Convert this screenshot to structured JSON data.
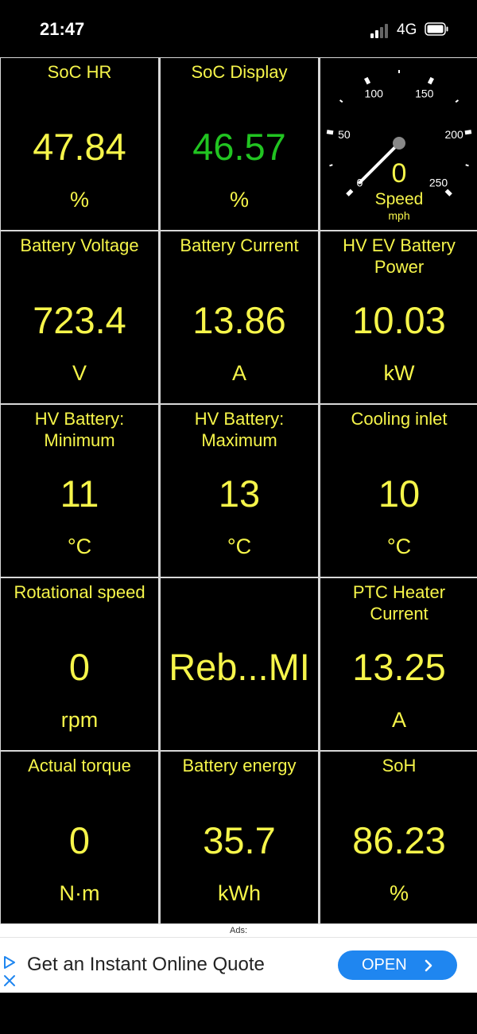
{
  "status_bar": {
    "time": "21:47",
    "network": "4G",
    "signal_bars_active": 2,
    "signal_bars_total": 4
  },
  "tiles": [
    {
      "label": "SoC HR",
      "value": "47.84",
      "unit": "%",
      "color": "#f6f54a"
    },
    {
      "label": "SoC Display",
      "value": "46.57",
      "unit": "%",
      "color": "#21c421"
    },
    {
      "type": "gauge"
    },
    {
      "label": "Battery Voltage",
      "value": "723.4",
      "unit": "V"
    },
    {
      "label": "Battery Current",
      "value": "13.86",
      "unit": "A"
    },
    {
      "label": "HV EV Battery Power",
      "value": "10.03",
      "unit": "kW"
    },
    {
      "label": "HV Battery: Minimum",
      "value": "11",
      "unit": "°C"
    },
    {
      "label": "HV Battery: Maximum",
      "value": "13",
      "unit": "°C"
    },
    {
      "label": "Cooling inlet",
      "value": "10",
      "unit": "°C"
    },
    {
      "label": "Rotational speed",
      "value": "0",
      "unit": "rpm"
    },
    {
      "label": "",
      "value": "Reb...MI",
      "unit": ""
    },
    {
      "label": "PTC Heater Current",
      "value": "13.25",
      "unit": "A"
    },
    {
      "label": "Actual torque",
      "value": "0",
      "unit": "N·m"
    },
    {
      "label": "Battery energy",
      "value": "35.7",
      "unit": "kWh"
    },
    {
      "label": "SoH",
      "value": "86.23",
      "unit": "%"
    }
  ],
  "gauge": {
    "label": "Speed",
    "unit": "mph",
    "value": 0,
    "value_text": "0",
    "ticks": [
      "0",
      "50",
      "100",
      "150",
      "200",
      "250"
    ],
    "min": 0,
    "max": 250
  },
  "ad": {
    "heading": "Ads:",
    "text": "Get an Instant Online Quote",
    "button_label": "OPEN",
    "button_color": "#1f86f0"
  },
  "colors": {
    "value_yellow": "#f6f54a",
    "value_green": "#21c421",
    "background": "#000000",
    "grid_lines": "#d8d8d8"
  }
}
